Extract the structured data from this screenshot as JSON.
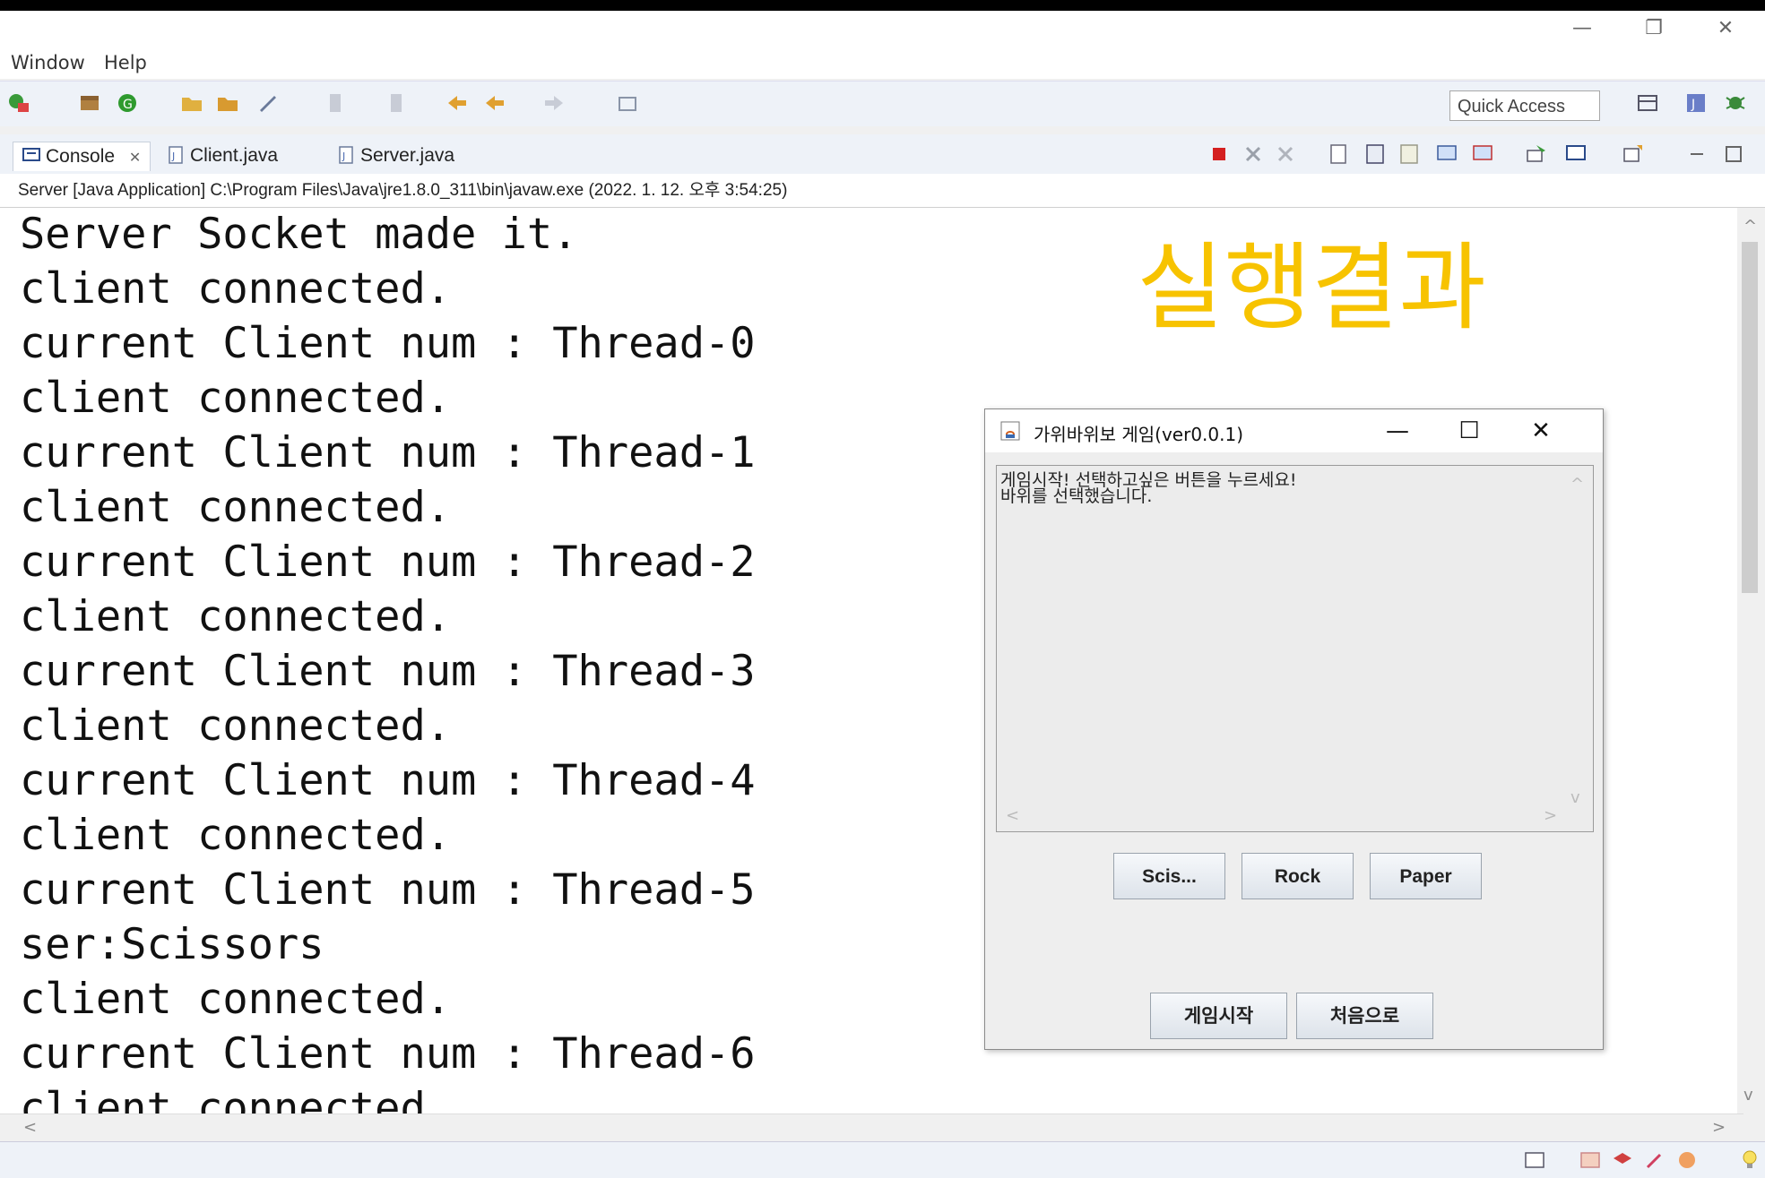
{
  "window": {
    "minimize": "—",
    "restore": "❐",
    "close": "✕"
  },
  "menu": {
    "items": [
      "Window",
      "Help"
    ]
  },
  "toolbar": {
    "quick_access": "Quick Access"
  },
  "tabs": [
    {
      "label": "Console",
      "close": "✕"
    },
    {
      "label": "Client.java"
    },
    {
      "label": "Server.java"
    }
  ],
  "console": {
    "path": "Server [Java Application] C:\\Program Files\\Java\\jre1.8.0_311\\bin\\javaw.exe (2022. 1. 12. 오후 3:54:25)",
    "lines": [
      "Server Socket made it.",
      "client connected.",
      "current Client num : Thread-0",
      "client connected.",
      "current Client num : Thread-1",
      "client connected.",
      "current Client num : Thread-2",
      "client connected.",
      "current Client num : Thread-3",
      "client connected.",
      "current Client num : Thread-4",
      "client connected.",
      "current Client num : Thread-5",
      "ser:Scissors",
      "client connected.",
      "current Client num : Thread-6",
      "client connected."
    ]
  },
  "overlay": {
    "text": "실행결과"
  },
  "dialog": {
    "title": "가위바위보 게임(ver0.0.1)",
    "minimize": "—",
    "maximize": "☐",
    "close": "✕",
    "log": [
      "게임시작! 선택하고싶은 버튼을 누르세요!",
      "바위를 선택했습니다."
    ],
    "buttons": {
      "scissors": "Scis...",
      "rock": "Rock",
      "paper": "Paper",
      "start": "게임시작",
      "home": "처음으로"
    }
  }
}
